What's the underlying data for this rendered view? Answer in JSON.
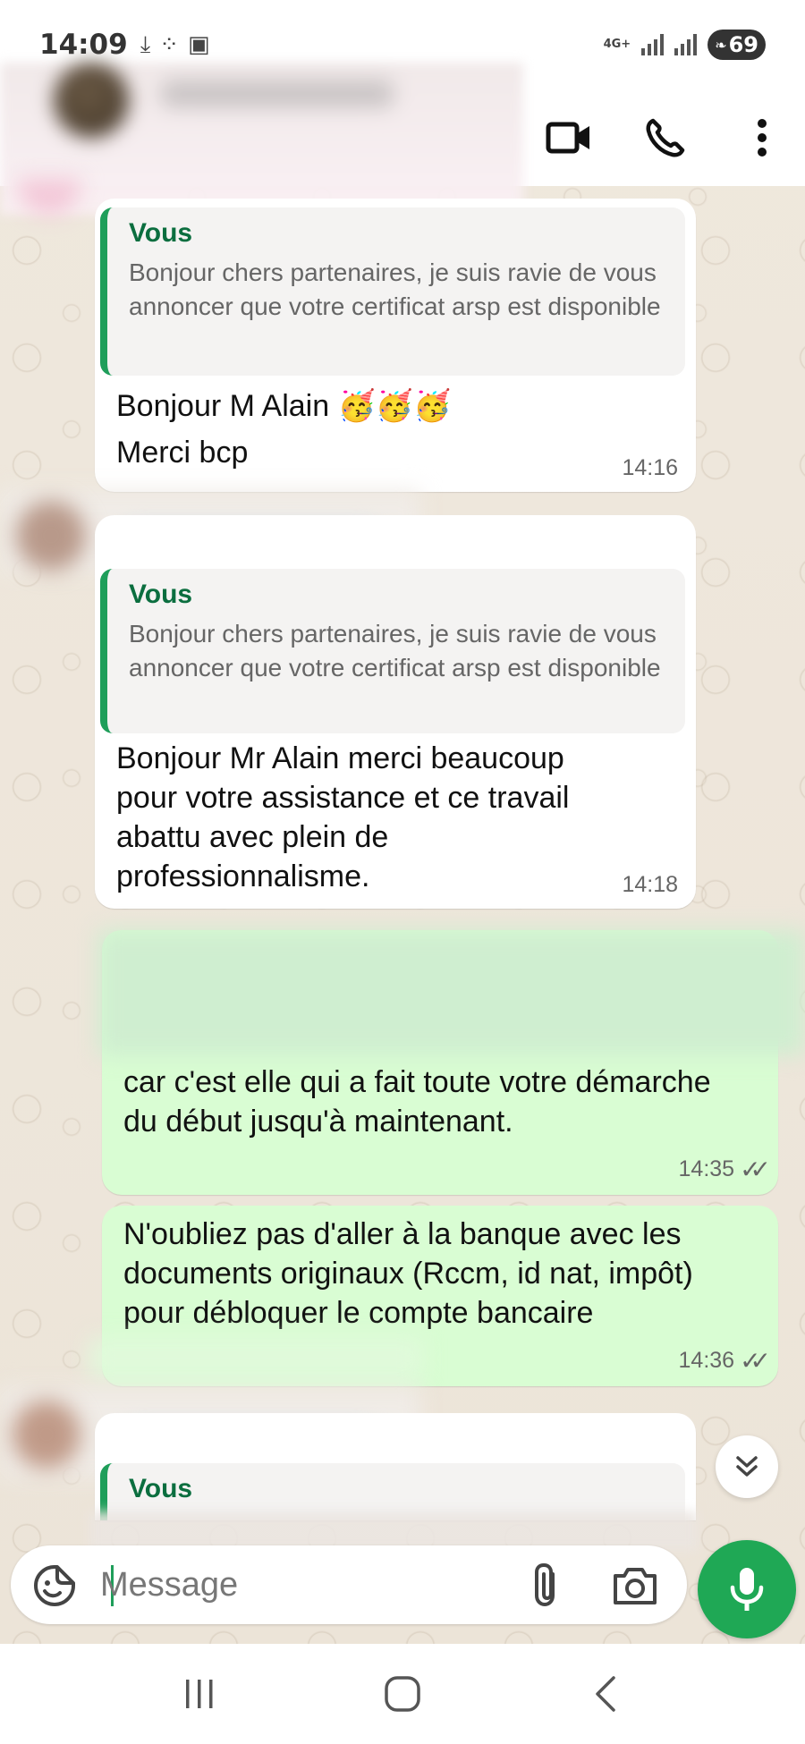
{
  "status_bar": {
    "time": "14:09",
    "network": "4G+",
    "battery": "69"
  },
  "chat": {
    "messages": [
      {
        "quote_author": "Vous",
        "quote_text": "Bonjour chers partenaires,  je suis ravie de vous annoncer que votre certificat arsp est disponible",
        "text_line1": "Bonjour M Alain 🥳🥳🥳",
        "text_line2": "Merci bcp",
        "time": "14:16"
      },
      {
        "quote_author": "Vous",
        "quote_text": "Bonjour chers partenaires,  je suis ravie de vous annoncer que votre certificat arsp est disponible",
        "text": "Bonjour Mr Alain merci  beaucoup pour votre assistance et ce travail abattu avec plein de professionnalisme.",
        "time": "14:18"
      },
      {
        "text": "car c'est elle qui a fait toute votre démarche du début jusqu'à maintenant.",
        "time": "14:35"
      },
      {
        "text": "N'oubliez pas d'aller à la banque avec les documents originaux (Rccm,  id nat, impôt) pour débloquer le compte bancaire",
        "time": "14:36"
      },
      {
        "quote_author": "Vous"
      }
    ]
  },
  "composer": {
    "placeholder": "Message"
  },
  "colors": {
    "outgoing_bubble": "#d9fdd3",
    "incoming_bubble": "#ffffff",
    "accent_green": "#1fa855",
    "quote_bar": "#1f9e5a"
  },
  "icons": [
    "video-call-icon",
    "voice-call-icon",
    "more-options-icon",
    "sticker-icon",
    "attach-icon",
    "camera-icon",
    "mic-icon",
    "scroll-down-icon",
    "recents-icon",
    "home-icon",
    "back-icon"
  ]
}
